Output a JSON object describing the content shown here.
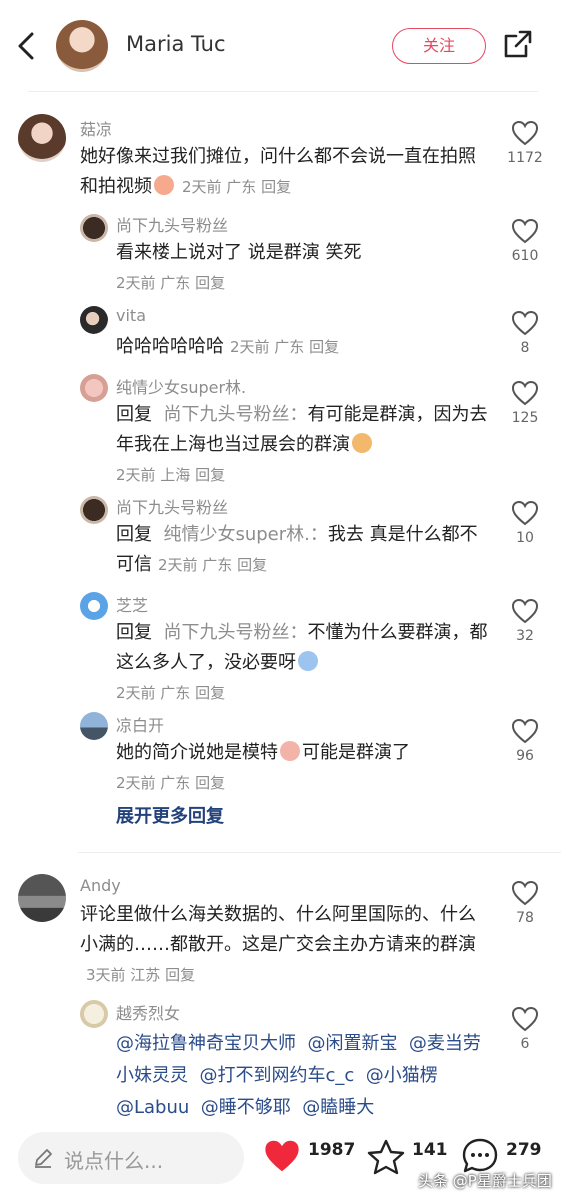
{
  "header": {
    "user_name": "Maria Tuc",
    "follow_label": "关注"
  },
  "comments": [
    {
      "user": "菇凉",
      "text": "她好像来过我们摊位，问什么都不会说一直在拍照和拍视频",
      "meta": "2天前  广东  回复",
      "likes": "1172"
    },
    {
      "user": "尚下九头号粉丝",
      "text": "看来楼上说对了 说是群演 笑死",
      "meta": "2天前  广东  回复",
      "likes": "610"
    },
    {
      "user": "vita",
      "text": "哈哈哈哈哈哈",
      "meta": "2天前  广东  回复",
      "likes": "8"
    },
    {
      "user": "纯情少女super林.",
      "reply_prefix": "回复",
      "reply_to": "尚下九头号粉丝：",
      "text": "有可能是群演，因为去年我在上海也当过展会的群演",
      "meta": "2天前  上海  回复",
      "likes": "125"
    },
    {
      "user": "尚下九头号粉丝",
      "reply_prefix": "回复",
      "reply_to": "纯情少女super林.：",
      "text": "我去 真是什么都不可信",
      "meta": "2天前  广东  回复",
      "likes": "10"
    },
    {
      "user": "芝芝",
      "reply_prefix": "回复",
      "reply_to": "尚下九头号粉丝：",
      "text": "不懂为什么要群演，都这么多人了，没必要呀",
      "meta": "2天前  广东  回复",
      "likes": "32"
    },
    {
      "user": "凉白开",
      "text": "她的简介说她是模特",
      "text2": "可能是群演了",
      "meta": "2天前  广东  回复",
      "likes": "96"
    },
    {
      "user": "Andy",
      "text": "评论里做什么海关数据的、什么阿里国际的、什么小满的……都散开。这是广交会主办方请来的群演",
      "meta": "3天前  江苏  回复",
      "likes": "78"
    },
    {
      "user": "越秀烈女",
      "mentions": [
        "@海拉鲁神奇宝贝大师",
        "@闲置新宝",
        "@麦当劳小妹灵灵",
        "@打不到网约车c_c",
        "@小猫楞",
        "@Labuu",
        "@睡不够耶",
        "@瞌睡大"
      ],
      "likes": "6"
    }
  ],
  "expand_label": "展开更多回复",
  "bottom_bar": {
    "placeholder": "说点什么...",
    "like_count": "1987",
    "star_count": "141",
    "comment_count": "279"
  },
  "watermark": "头条 @P星爵士兵团",
  "colors": {
    "accent": "#e8475f",
    "link": "#23417a"
  },
  "icons": [
    "back-arrow-icon",
    "share-icon",
    "heart-outline-icon",
    "heart-filled-icon",
    "star-icon",
    "comment-bubble-icon",
    "pen-icon"
  ]
}
